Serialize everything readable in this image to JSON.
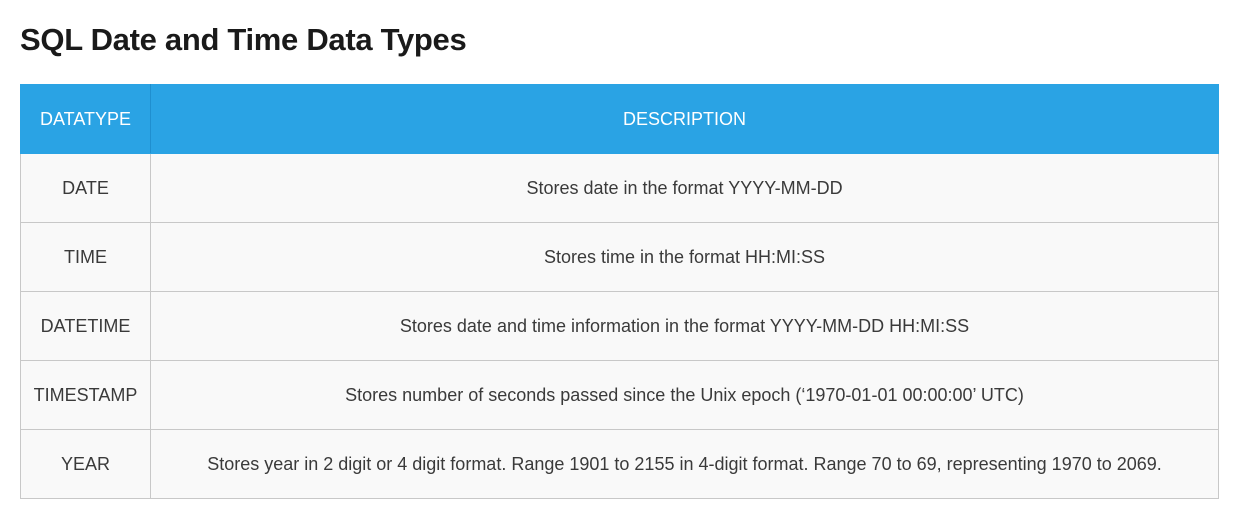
{
  "page": {
    "title": "SQL Date and Time Data Types"
  },
  "table": {
    "headers": {
      "datatype": "DATATYPE",
      "description": "DESCRIPTION"
    },
    "rows": [
      {
        "datatype": "DATE",
        "description": "Stores date in the format YYYY-MM-DD"
      },
      {
        "datatype": "TIME",
        "description": "Stores time in the format HH:MI:SS"
      },
      {
        "datatype": "DATETIME",
        "description": "Stores date and time information in the format YYYY-MM-DD HH:MI:SS"
      },
      {
        "datatype": "TIMESTAMP",
        "description": "Stores number of seconds passed since the Unix epoch (‘1970-01-01 00:00:00’ UTC)"
      },
      {
        "datatype": "YEAR",
        "description": "Stores year in 2 digit or 4 digit format. Range 1901 to 2155 in 4-digit format. Range 70 to 69, representing 1970 to 2069."
      }
    ]
  },
  "colors": {
    "header_background": "#2aa3e4",
    "header_text": "#ffffff",
    "row_background": "#f9f9f9",
    "border": "#c8c8c8"
  }
}
